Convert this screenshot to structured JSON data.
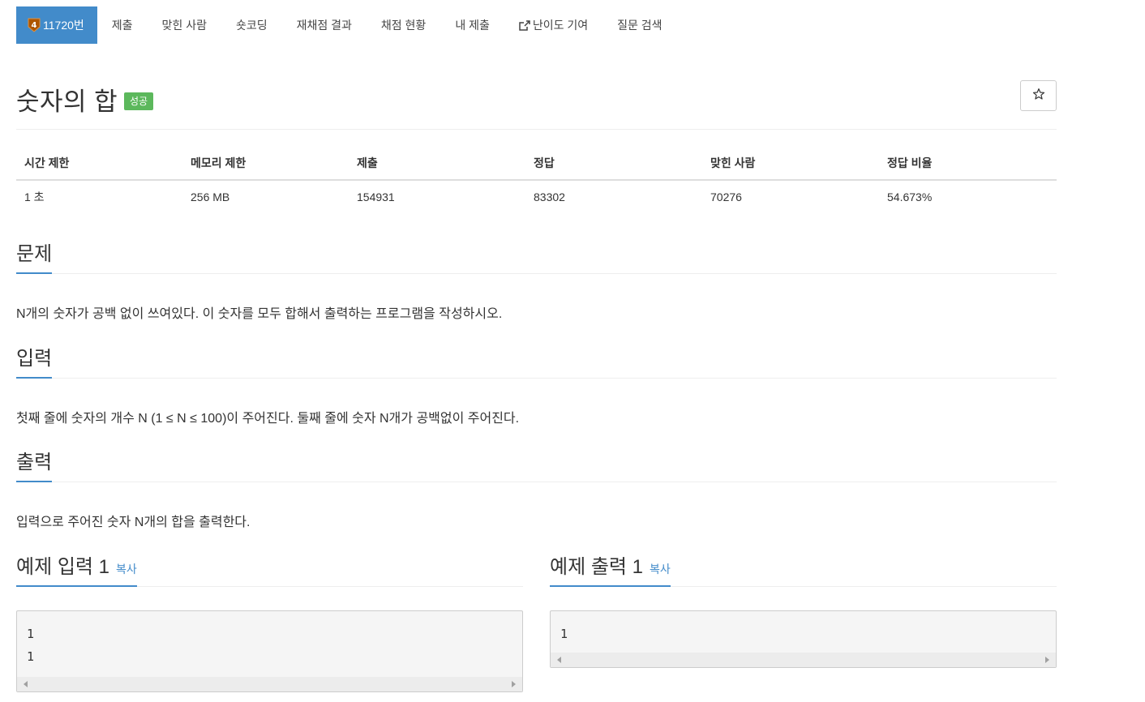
{
  "nav": {
    "problem_number": "11720번",
    "tier_level": "4",
    "tier_color": "#ad5600",
    "items": [
      "제출",
      "맞힌 사람",
      "숏코딩",
      "재채점 결과",
      "채점 현황",
      "내 제출",
      "난이도 기여",
      "질문 검색"
    ]
  },
  "title": "숫자의 합",
  "status_badge": "성공",
  "star_icon": "star-outline-icon",
  "info": {
    "headers": [
      "시간 제한",
      "메모리 제한",
      "제출",
      "정답",
      "맞힌 사람",
      "정답 비율"
    ],
    "values": [
      "1 초",
      "256 MB",
      "154931",
      "83302",
      "70276",
      "54.673%"
    ]
  },
  "sections": {
    "problem": {
      "heading": "문제",
      "text": "N개의 숫자가 공백 없이 쓰여있다. 이 숫자를 모두 합해서 출력하는 프로그램을 작성하시오."
    },
    "input": {
      "heading": "입력",
      "text": "첫째 줄에 숫자의 개수 N (1 ≤ N ≤ 100)이 주어진다. 둘째 줄에 숫자 N개가 공백없이 주어진다."
    },
    "output": {
      "heading": "출력",
      "text": "입력으로 주어진 숫자 N개의 합을 출력한다."
    }
  },
  "samples": {
    "input": {
      "heading": "예제 입력 1",
      "copy": "복사",
      "content": "1\n1"
    },
    "output": {
      "heading": "예제 출력 1",
      "copy": "복사",
      "content": "1"
    }
  },
  "colors": {
    "accent": "#428bca",
    "success": "#5cb85c"
  }
}
